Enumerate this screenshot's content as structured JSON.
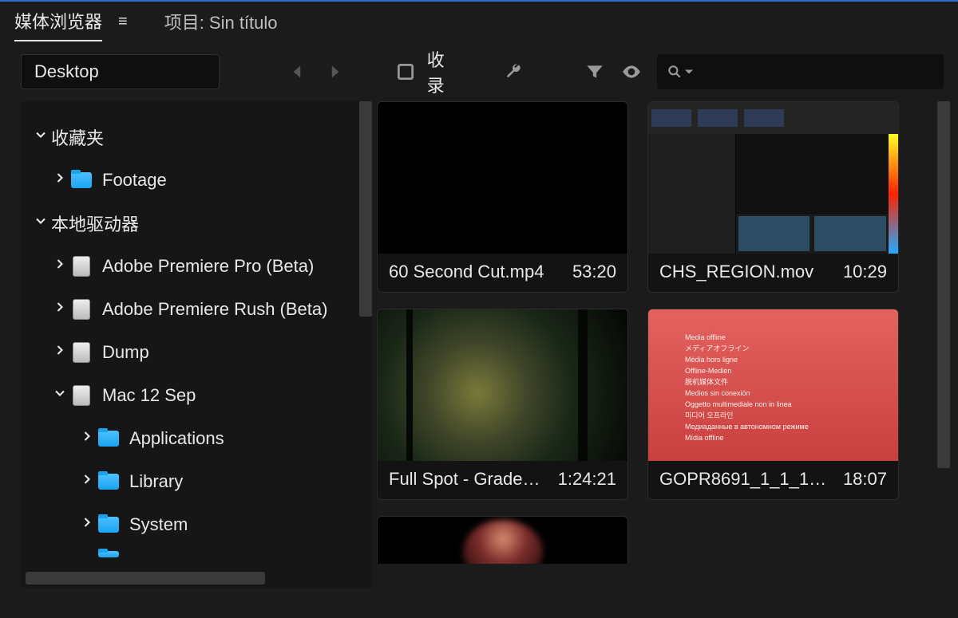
{
  "tabs": {
    "active": "媒体浏览器",
    "inactive": "项目: Sin título"
  },
  "toolbar": {
    "dropdown_value": "Desktop",
    "ingest_label": "收录",
    "search_placeholder": ""
  },
  "tree": {
    "sections": [
      {
        "label": "收藏夹",
        "expanded": true,
        "children": [
          {
            "label": "Footage",
            "icon": "folder",
            "expanded": false
          }
        ]
      },
      {
        "label": "本地驱动器",
        "expanded": true,
        "children": [
          {
            "label": "Adobe Premiere Pro (Beta)",
            "icon": "drive",
            "expanded": false
          },
          {
            "label": "Adobe Premiere Rush (Beta)",
            "icon": "drive",
            "expanded": false
          },
          {
            "label": "Dump",
            "icon": "drive",
            "expanded": false
          },
          {
            "label": "Mac 12 Sep",
            "icon": "drive",
            "expanded": true,
            "children": [
              {
                "label": "Applications",
                "icon": "folder",
                "expanded": false
              },
              {
                "label": "Library",
                "icon": "folder",
                "expanded": false
              },
              {
                "label": "System",
                "icon": "folder",
                "expanded": false
              }
            ]
          }
        ]
      }
    ]
  },
  "items": [
    {
      "name": "60 Second Cut.mp4",
      "duration": "53:20",
      "thumb": "black"
    },
    {
      "name": "CHS_REGION.mov",
      "duration": "10:29",
      "thumb": "ui"
    },
    {
      "name": "Full Spot - Grade…",
      "duration": "1:24:21",
      "thumb": "forest"
    },
    {
      "name": "GOPR8691_1_1_1…",
      "duration": "18:07",
      "thumb": "offline"
    }
  ],
  "offline_text": [
    "Media offline",
    "メディアオフライン",
    "Média hors ligne",
    "Offline-Medien",
    "脱机媒体文件",
    "Medios sin conexión",
    "Oggetto multimediale non in linea",
    "미디어 오프라인",
    "Медиаданные в автономном режиме",
    "Mídia offline"
  ]
}
